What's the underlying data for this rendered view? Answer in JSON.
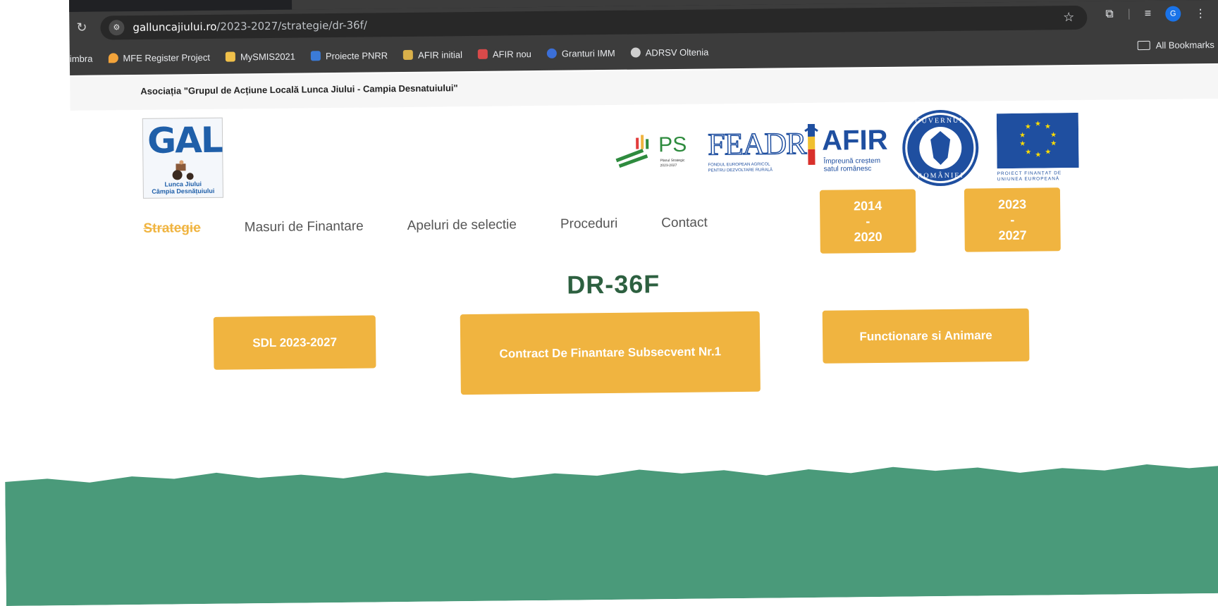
{
  "browser": {
    "url_host": "galluncajiului.ro",
    "url_path": "/2023-2027/strategie/dr-36f/",
    "profile_initial": "G",
    "bookmarks": [
      {
        "label": "imbra",
        "icon_color": "#3c3c3c"
      },
      {
        "label": "MFE Register Project",
        "icon_color": "#f2a33a"
      },
      {
        "label": "MySMIS2021",
        "icon_color": "#f0c04a"
      },
      {
        "label": "Proiecte PNRR",
        "icon_color": "#3b7bd8"
      },
      {
        "label": "AFIR initial",
        "icon_color": "#d9b04a"
      },
      {
        "label": "AFIR nou",
        "icon_color": "#d94a4a"
      },
      {
        "label": "Granturi IMM",
        "icon_color": "#3b6fd8"
      },
      {
        "label": "ADRSV Oltenia",
        "icon_color": "#cfcfcf"
      }
    ],
    "all_bookmarks": "All Bookmarks"
  },
  "page": {
    "association": "Asociația \"Grupul de Acțiune Locală Lunca Jiului - Campia Desnatuiului\"",
    "logo": {
      "big": "GAL",
      "line1": "Lunca Jiului",
      "line2": "Câmpia Desnățuiului"
    },
    "partners": {
      "ps": {
        "big": "PS",
        "small1": "Planul Strategic",
        "small2": "2023-2027"
      },
      "feadr": {
        "big": "FEADR",
        "small1": "FONDUL EUROPEAN AGRICOL",
        "small2": "PENTRU DEZVOLTARE RURALĂ"
      },
      "afir": {
        "big": "AFIR",
        "small1": "Împreună creștem",
        "small2": "satul românesc"
      },
      "gov": {
        "top": "GUVERNUL",
        "bottom": "ROMÂNIEI"
      },
      "eu": {
        "line1": "PROIECT FINANȚAT DE",
        "line2": "UNIUNEA EUROPEANĂ"
      }
    },
    "nav": [
      "Strategie",
      "Masuri de Finantare",
      "Apeluri de selectie",
      "Proceduri",
      "Contact"
    ],
    "periods": [
      {
        "top": "2014",
        "mid": "-",
        "bottom": "2020"
      },
      {
        "top": "2023",
        "mid": "-",
        "bottom": "2027"
      }
    ],
    "title": "DR-36F",
    "documents": [
      "SDL 2023-2027",
      "Contract De Finantare Subsecvent Nr.1",
      "Functionare si Animare"
    ]
  },
  "colors": {
    "accent": "#f0b440",
    "title": "#2d6040",
    "footer": "#4a9a7a"
  }
}
